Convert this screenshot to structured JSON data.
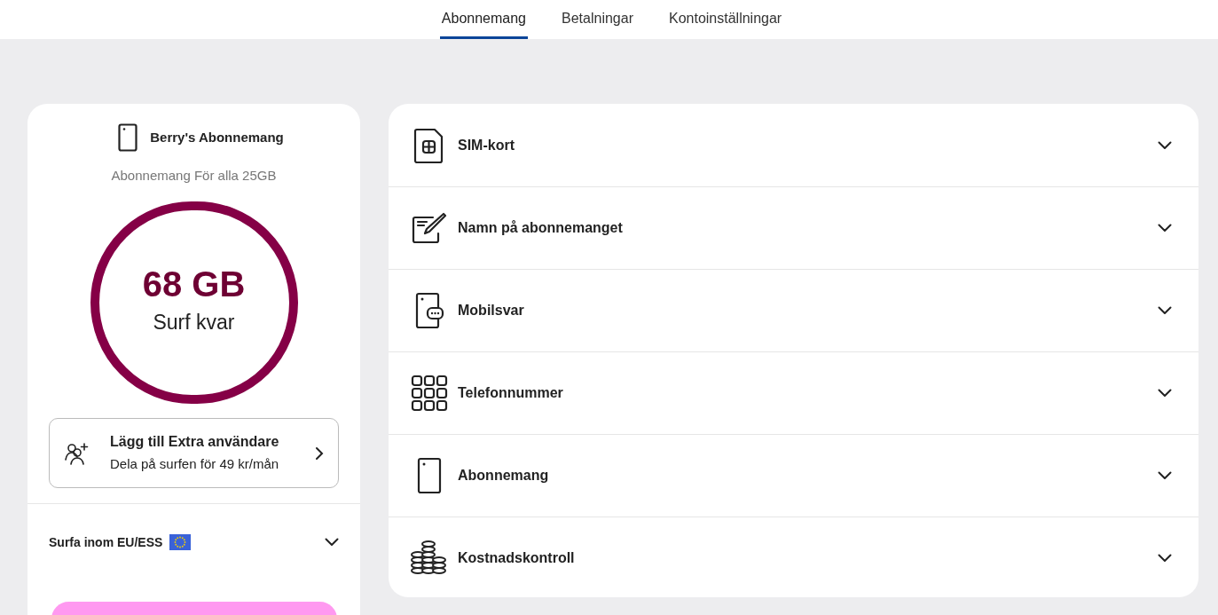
{
  "tabs": [
    {
      "label": "Abonnemang",
      "selected": true
    },
    {
      "label": "Betalningar",
      "selected": false
    },
    {
      "label": "Kontoinställningar",
      "selected": false
    }
  ],
  "subscription": {
    "title": "Berry's Abonnemang",
    "plan": "Abonnemang För alla 25GB",
    "amount": "68 GB",
    "amount_caption": "Surf kvar"
  },
  "extra_user": {
    "title": "Lägg till Extra användare",
    "subtitle": "Dela på surfen för 49 kr/mån"
  },
  "eu_roaming": {
    "label": "Surfa inom EU/ESS",
    "expanded": false
  },
  "sections": [
    {
      "kind": "sim",
      "label": "SIM-kort",
      "expanded": false
    },
    {
      "kind": "edit",
      "label": "Namn på abonnemanget",
      "expanded": false
    },
    {
      "kind": "voicemail",
      "label": "Mobilsvar",
      "expanded": false
    },
    {
      "kind": "keypad",
      "label": "Telefonnummer",
      "expanded": false
    },
    {
      "kind": "phone",
      "label": "Abonnemang",
      "expanded": false
    },
    {
      "kind": "coins",
      "label": "Kostnadskontroll",
      "expanded": false
    }
  ]
}
